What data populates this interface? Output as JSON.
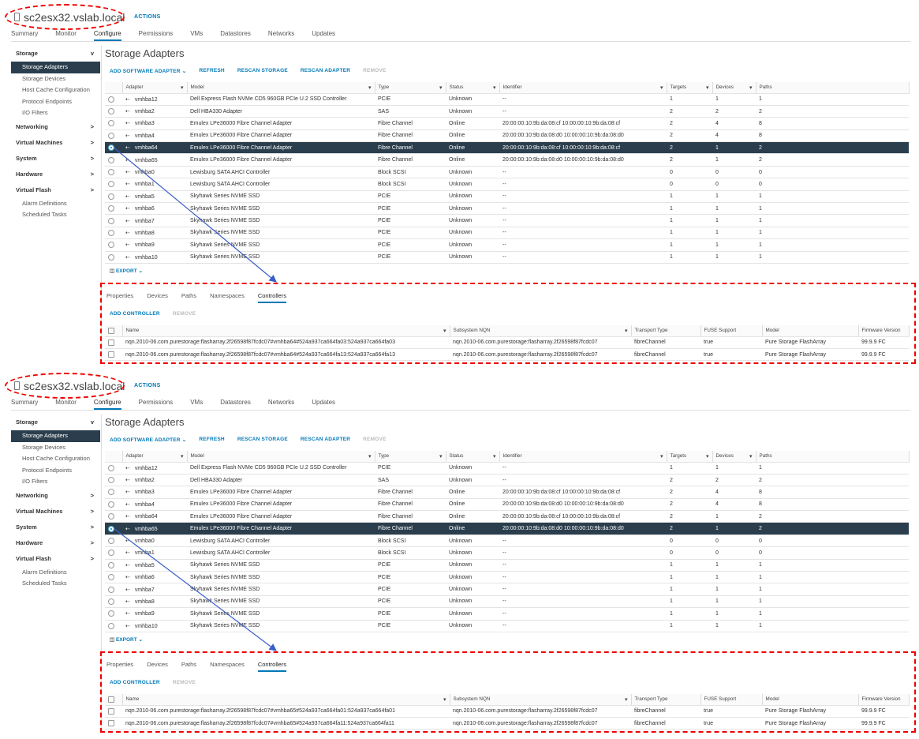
{
  "colors": {
    "accent": "#0079b8",
    "selected_row": "#2b3e4d",
    "annotation": "#e00000"
  },
  "panels": [
    {
      "host_title": "sc2esx32.vslab.local",
      "actions": "ACTIONS",
      "tabs": [
        "Summary",
        "Monitor",
        "Configure",
        "Permissions",
        "VMs",
        "Datastores",
        "Networks",
        "Updates"
      ],
      "active_tab": 2,
      "sidebar": [
        {
          "label": "Storage",
          "group": true,
          "chev": "v"
        },
        {
          "label": "Storage Adapters",
          "selected": true
        },
        {
          "label": "Storage Devices"
        },
        {
          "label": "Host Cache Configuration"
        },
        {
          "label": "Protocol Endpoints"
        },
        {
          "label": "I/O Filters"
        },
        {
          "label": "Networking",
          "group": true,
          "chev": ">"
        },
        {
          "label": "Virtual Machines",
          "group": true,
          "chev": ">"
        },
        {
          "label": "System",
          "group": true,
          "chev": ">"
        },
        {
          "label": "Hardware",
          "group": true,
          "chev": ">"
        },
        {
          "label": "Virtual Flash",
          "group": true,
          "chev": ">"
        },
        {
          "label": "Alarm Definitions"
        },
        {
          "label": "Scheduled Tasks"
        }
      ],
      "page_title": "Storage Adapters",
      "toolbar": [
        {
          "label": "ADD SOFTWARE ADAPTER ⌄"
        },
        {
          "label": "REFRESH"
        },
        {
          "label": "RESCAN STORAGE"
        },
        {
          "label": "RESCAN ADAPTER"
        },
        {
          "label": "REMOVE",
          "disabled": true
        }
      ],
      "columns": [
        "Adapter",
        "Model",
        "Type",
        "Status",
        "Identifier",
        "Targets",
        "Devices",
        "Paths"
      ],
      "selected_row": 4,
      "rows": [
        [
          "vmhba12",
          "Dell Express Flash NVMe CD5 960GB PCIe U.2 SSD Controller",
          "PCIE",
          "Unknown",
          "--",
          "1",
          "1",
          "1"
        ],
        [
          "vmhba2",
          "Dell HBA330 Adapter",
          "SAS",
          "Unknown",
          "--",
          "2",
          "2",
          "2"
        ],
        [
          "vmhba3",
          "Emulex LPe36000 Fibre Channel Adapter",
          "Fibre Channel",
          "Online",
          "20:00:00:10:9b:da:08:cf 10:00:00:10:9b:da:08:cf",
          "2",
          "4",
          "8"
        ],
        [
          "vmhba4",
          "Emulex LPe36000 Fibre Channel Adapter",
          "Fibre Channel",
          "Online",
          "20:00:00:10:9b:da:08:d0 10:00:00:10:9b:da:08:d0",
          "2",
          "4",
          "8"
        ],
        [
          "vmhba64",
          "Emulex LPe36000 Fibre Channel Adapter",
          "Fibre Channel",
          "Online",
          "20:00:00:10:9b:da:08:cf 10:00:00:10:9b:da:08:cf",
          "2",
          "1",
          "2"
        ],
        [
          "vmhba65",
          "Emulex LPe36000 Fibre Channel Adapter",
          "Fibre Channel",
          "Online",
          "20:00:00:10:9b:da:08:d0 10:00:00:10:9b:da:08:d0",
          "2",
          "1",
          "2"
        ],
        [
          "vmhba0",
          "Lewisburg SATA AHCI Controller",
          "Block SCSI",
          "Unknown",
          "--",
          "0",
          "0",
          "0"
        ],
        [
          "vmhba1",
          "Lewisburg SATA AHCI Controller",
          "Block SCSI",
          "Unknown",
          "--",
          "0",
          "0",
          "0"
        ],
        [
          "vmhba5",
          "Skyhawk Series NVME SSD",
          "PCIE",
          "Unknown",
          "--",
          "1",
          "1",
          "1"
        ],
        [
          "vmhba6",
          "Skyhawk Series NVME SSD",
          "PCIE",
          "Unknown",
          "--",
          "1",
          "1",
          "1"
        ],
        [
          "vmhba7",
          "Skyhawk Series NVME SSD",
          "PCIE",
          "Unknown",
          "--",
          "1",
          "1",
          "1"
        ],
        [
          "vmhba8",
          "Skyhawk Series NVME SSD",
          "PCIE",
          "Unknown",
          "--",
          "1",
          "1",
          "1"
        ],
        [
          "vmhba9",
          "Skyhawk Series NVME SSD",
          "PCIE",
          "Unknown",
          "--",
          "1",
          "1",
          "1"
        ],
        [
          "vmhba10",
          "Skyhawk Series NVME SSD",
          "PCIE",
          "Unknown",
          "--",
          "1",
          "1",
          "1"
        ]
      ],
      "export": "EXPORT ⌄",
      "detail_tabs": [
        "Properties",
        "Devices",
        "Paths",
        "Namespaces",
        "Controllers"
      ],
      "active_detail_tab": 4,
      "detail_toolbar": [
        {
          "label": "ADD CONTROLLER"
        },
        {
          "label": "REMOVE",
          "disabled": true
        }
      ],
      "ctrl_columns": [
        "Name",
        "Subsystem NQN",
        "Transport Type",
        "FUSE Support",
        "Model",
        "Firmware Version"
      ],
      "ctrl_rows": [
        [
          "nqn.2010-06.com.purestorage:flasharray.2f26598f87fcdc07#vmhba64#524a937ca664fa03:524a937ca664fa03",
          "nqn.2010-06.com.purestorage:flasharray.2f26598f87fcdc07",
          "fibreChannel",
          "true",
          "Pure Storage FlashArray",
          "99.9.9 FC"
        ],
        [
          "nqn.2010-06.com.purestorage:flasharray.2f26598f87fcdc07#vmhba64#524a937ca664fa13:524a937ca664fa13",
          "nqn.2010-06.com.purestorage:flasharray.2f26598f87fcdc07",
          "fibreChannel",
          "true",
          "Pure Storage FlashArray",
          "99.9.9 FC"
        ]
      ]
    },
    {
      "host_title": "sc2esx32.vslab.local",
      "actions": "ACTIONS",
      "tabs": [
        "Summary",
        "Monitor",
        "Configure",
        "Permissions",
        "VMs",
        "Datastores",
        "Networks",
        "Updates"
      ],
      "active_tab": 2,
      "sidebar": [
        {
          "label": "Storage",
          "group": true,
          "chev": "v"
        },
        {
          "label": "Storage Adapters",
          "selected": true
        },
        {
          "label": "Storage Devices"
        },
        {
          "label": "Host Cache Configuration"
        },
        {
          "label": "Protocol Endpoints"
        },
        {
          "label": "I/O Filters"
        },
        {
          "label": "Networking",
          "group": true,
          "chev": ">"
        },
        {
          "label": "Virtual Machines",
          "group": true,
          "chev": ">"
        },
        {
          "label": "System",
          "group": true,
          "chev": ">"
        },
        {
          "label": "Hardware",
          "group": true,
          "chev": ">"
        },
        {
          "label": "Virtual Flash",
          "group": true,
          "chev": ">"
        },
        {
          "label": "Alarm Definitions"
        },
        {
          "label": "Scheduled Tasks"
        }
      ],
      "page_title": "Storage Adapters",
      "toolbar": [
        {
          "label": "ADD SOFTWARE ADAPTER ⌄"
        },
        {
          "label": "REFRESH"
        },
        {
          "label": "RESCAN STORAGE"
        },
        {
          "label": "RESCAN ADAPTER"
        },
        {
          "label": "REMOVE",
          "disabled": true
        }
      ],
      "columns": [
        "Adapter",
        "Model",
        "Type",
        "Status",
        "Identifier",
        "Targets",
        "Devices",
        "Paths"
      ],
      "selected_row": 5,
      "rows": [
        [
          "vmhba12",
          "Dell Express Flash NVMe CD5 960GB PCIe U.2 SSD Controller",
          "PCIE",
          "Unknown",
          "--",
          "1",
          "1",
          "1"
        ],
        [
          "vmhba2",
          "Dell HBA330 Adapter",
          "SAS",
          "Unknown",
          "--",
          "2",
          "2",
          "2"
        ],
        [
          "vmhba3",
          "Emulex LPe36000 Fibre Channel Adapter",
          "Fibre Channel",
          "Online",
          "20:00:00:10:9b:da:08:cf 10:00:00:10:9b:da:08:cf",
          "2",
          "4",
          "8"
        ],
        [
          "vmhba4",
          "Emulex LPe36000 Fibre Channel Adapter",
          "Fibre Channel",
          "Online",
          "20:00:00:10:9b:da:08:d0 10:00:00:10:9b:da:08:d0",
          "2",
          "4",
          "8"
        ],
        [
          "vmhba64",
          "Emulex LPe36000 Fibre Channel Adapter",
          "Fibre Channel",
          "Online",
          "20:00:00:10:9b:da:08:cf 10:00:00:10:9b:da:08:cf",
          "2",
          "1",
          "2"
        ],
        [
          "vmhba65",
          "Emulex LPe36000 Fibre Channel Adapter",
          "Fibre Channel",
          "Online",
          "20:00:00:10:9b:da:08:d0 10:00:00:10:9b:da:08:d0",
          "2",
          "1",
          "2"
        ],
        [
          "vmhba0",
          "Lewisburg SATA AHCI Controller",
          "Block SCSI",
          "Unknown",
          "--",
          "0",
          "0",
          "0"
        ],
        [
          "vmhba1",
          "Lewisburg SATA AHCI Controller",
          "Block SCSI",
          "Unknown",
          "--",
          "0",
          "0",
          "0"
        ],
        [
          "vmhba5",
          "Skyhawk Series NVME SSD",
          "PCIE",
          "Unknown",
          "--",
          "1",
          "1",
          "1"
        ],
        [
          "vmhba6",
          "Skyhawk Series NVME SSD",
          "PCIE",
          "Unknown",
          "--",
          "1",
          "1",
          "1"
        ],
        [
          "vmhba7",
          "Skyhawk Series NVME SSD",
          "PCIE",
          "Unknown",
          "--",
          "1",
          "1",
          "1"
        ],
        [
          "vmhba8",
          "Skyhawk Series NVME SSD",
          "PCIE",
          "Unknown",
          "--",
          "1",
          "1",
          "1"
        ],
        [
          "vmhba9",
          "Skyhawk Series NVME SSD",
          "PCIE",
          "Unknown",
          "--",
          "1",
          "1",
          "1"
        ],
        [
          "vmhba10",
          "Skyhawk Series NVME SSD",
          "PCIE",
          "Unknown",
          "--",
          "1",
          "1",
          "1"
        ]
      ],
      "export": "EXPORT ⌄",
      "detail_tabs": [
        "Properties",
        "Devices",
        "Paths",
        "Namespaces",
        "Controllers"
      ],
      "active_detail_tab": 4,
      "detail_toolbar": [
        {
          "label": "ADD CONTROLLER"
        },
        {
          "label": "REMOVE",
          "disabled": true
        }
      ],
      "ctrl_columns": [
        "Name",
        "Subsystem NQN",
        "Transport Type",
        "FUSE Support",
        "Model",
        "Firmware Version"
      ],
      "ctrl_rows": [
        [
          "nqn.2010-06.com.purestorage:flasharray.2f26598f87fcdc07#vmhba65#524a937ca664fa01:524a937ca664fa01",
          "nqn.2010-06.com.purestorage:flasharray.2f26598f87fcdc07",
          "fibreChannel",
          "true",
          "Pure Storage FlashArray",
          "99.9.9 FC"
        ],
        [
          "nqn.2010-06.com.purestorage:flasharray.2f26598f87fcdc07#vmhba65#524a937ca664fa11:524a937ca664fa11",
          "nqn.2010-06.com.purestorage:flasharray.2f26598f87fcdc07",
          "fibreChannel",
          "true",
          "Pure Storage FlashArray",
          "99.9.9 FC"
        ]
      ]
    }
  ]
}
